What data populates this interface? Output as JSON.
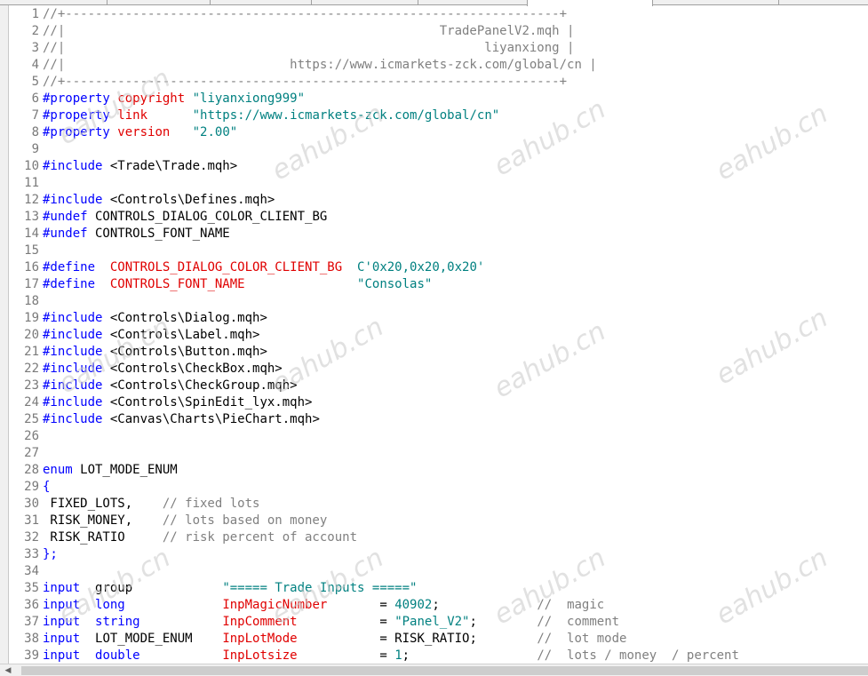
{
  "editor": {
    "lines": [
      {
        "n": "1",
        "parts": [
          [
            "c",
            "//+------------------------------------------------------------------+"
          ]
        ]
      },
      {
        "n": "2",
        "parts": [
          [
            "c",
            "//|                                                  TradePanelV2.mqh |"
          ]
        ]
      },
      {
        "n": "3",
        "parts": [
          [
            "c",
            "//|                                                        liyanxiong |"
          ]
        ]
      },
      {
        "n": "4",
        "parts": [
          [
            "c",
            "//|                              https://www.icmarkets-zck.com/global/cn |"
          ]
        ]
      },
      {
        "n": "5",
        "parts": [
          [
            "c",
            "//+------------------------------------------------------------------+"
          ]
        ]
      },
      {
        "n": "6",
        "parts": [
          [
            "k",
            "#property"
          ],
          [
            "t",
            " "
          ],
          [
            "r",
            "copyright"
          ],
          [
            "t",
            " "
          ],
          [
            "s",
            "\"liyanxiong999\""
          ]
        ]
      },
      {
        "n": "7",
        "parts": [
          [
            "k",
            "#property"
          ],
          [
            "t",
            " "
          ],
          [
            "r",
            "link"
          ],
          [
            "t",
            "      "
          ],
          [
            "s",
            "\"https://www.icmarkets-zck.com/global/cn\""
          ]
        ]
      },
      {
        "n": "8",
        "parts": [
          [
            "k",
            "#property"
          ],
          [
            "t",
            " "
          ],
          [
            "r",
            "version"
          ],
          [
            "t",
            "   "
          ],
          [
            "s",
            "\"2.00\""
          ]
        ]
      },
      {
        "n": "9",
        "parts": []
      },
      {
        "n": "10",
        "parts": [
          [
            "k",
            "#include"
          ],
          [
            "t",
            " <Trade\\Trade.mqh>"
          ]
        ]
      },
      {
        "n": "11",
        "parts": []
      },
      {
        "n": "12",
        "parts": [
          [
            "k",
            "#include"
          ],
          [
            "t",
            " <Controls\\Defines.mqh>"
          ]
        ]
      },
      {
        "n": "13",
        "parts": [
          [
            "k",
            "#undef"
          ],
          [
            "t",
            " CONTROLS_DIALOG_COLOR_CLIENT_BG"
          ]
        ]
      },
      {
        "n": "14",
        "parts": [
          [
            "k",
            "#undef"
          ],
          [
            "t",
            " CONTROLS_FONT_NAME"
          ]
        ]
      },
      {
        "n": "15",
        "parts": []
      },
      {
        "n": "16",
        "parts": [
          [
            "k",
            "#define"
          ],
          [
            "t",
            "  "
          ],
          [
            "r",
            "CONTROLS_DIALOG_COLOR_CLIENT_BG"
          ],
          [
            "t",
            "  "
          ],
          [
            "s",
            "C'0x20,0x20,0x20'"
          ]
        ]
      },
      {
        "n": "17",
        "parts": [
          [
            "k",
            "#define"
          ],
          [
            "t",
            "  "
          ],
          [
            "r",
            "CONTROLS_FONT_NAME"
          ],
          [
            "t",
            "               "
          ],
          [
            "s",
            "\"Consolas\""
          ]
        ]
      },
      {
        "n": "18",
        "parts": []
      },
      {
        "n": "19",
        "parts": [
          [
            "k",
            "#include"
          ],
          [
            "t",
            " <Controls\\Dialog.mqh>"
          ]
        ]
      },
      {
        "n": "20",
        "parts": [
          [
            "k",
            "#include"
          ],
          [
            "t",
            " <Controls\\Label.mqh>"
          ]
        ]
      },
      {
        "n": "21",
        "parts": [
          [
            "k",
            "#include"
          ],
          [
            "t",
            " <Controls\\Button.mqh>"
          ]
        ]
      },
      {
        "n": "22",
        "parts": [
          [
            "k",
            "#include"
          ],
          [
            "t",
            " <Controls\\CheckBox.mqh>"
          ]
        ]
      },
      {
        "n": "23",
        "parts": [
          [
            "k",
            "#include"
          ],
          [
            "t",
            " <Controls\\CheckGroup.mqh>"
          ]
        ]
      },
      {
        "n": "24",
        "parts": [
          [
            "k",
            "#include"
          ],
          [
            "t",
            " <Controls\\SpinEdit_lyx.mqh>"
          ]
        ]
      },
      {
        "n": "25",
        "parts": [
          [
            "k",
            "#include"
          ],
          [
            "t",
            " <Canvas\\Charts\\PieChart.mqh>"
          ]
        ]
      },
      {
        "n": "26",
        "parts": []
      },
      {
        "n": "27",
        "parts": []
      },
      {
        "n": "28",
        "parts": [
          [
            "k",
            "enum"
          ],
          [
            "t",
            " LOT_MODE_ENUM"
          ]
        ]
      },
      {
        "n": "29",
        "parts": [
          [
            "k",
            "{"
          ]
        ]
      },
      {
        "n": "30",
        "parts": [
          [
            "t",
            " FIXED_LOTS,    "
          ],
          [
            "c",
            "// fixed lots"
          ]
        ]
      },
      {
        "n": "31",
        "parts": [
          [
            "t",
            " RISK_MONEY,    "
          ],
          [
            "c",
            "// lots based on money"
          ]
        ]
      },
      {
        "n": "32",
        "parts": [
          [
            "t",
            " RISK_RATIO     "
          ],
          [
            "c",
            "// risk percent of account"
          ]
        ]
      },
      {
        "n": "33",
        "parts": [
          [
            "k",
            "};"
          ]
        ]
      },
      {
        "n": "34",
        "parts": []
      },
      {
        "n": "35",
        "parts": [
          [
            "k",
            "input"
          ],
          [
            "t",
            "  group            "
          ],
          [
            "s",
            "\"===== Trade Inputs =====\""
          ]
        ]
      },
      {
        "n": "36",
        "parts": [
          [
            "k",
            "input"
          ],
          [
            "t",
            "  "
          ],
          [
            "k",
            "long"
          ],
          [
            "t",
            "             "
          ],
          [
            "r",
            "InpMagicNumber"
          ],
          [
            "t",
            "       = "
          ],
          [
            "num",
            "40902"
          ],
          [
            "t",
            ";             "
          ],
          [
            "c",
            "//  magic"
          ]
        ]
      },
      {
        "n": "37",
        "parts": [
          [
            "k",
            "input"
          ],
          [
            "t",
            "  "
          ],
          [
            "k",
            "string"
          ],
          [
            "t",
            "           "
          ],
          [
            "r",
            "InpComment"
          ],
          [
            "t",
            "           = "
          ],
          [
            "s",
            "\"Panel_V2\""
          ],
          [
            "t",
            ";        "
          ],
          [
            "c",
            "//  comment"
          ]
        ]
      },
      {
        "n": "38",
        "parts": [
          [
            "k",
            "input"
          ],
          [
            "t",
            "  LOT_MODE_ENUM    "
          ],
          [
            "r",
            "InpLotMode"
          ],
          [
            "t",
            "           = RISK_RATIO;        "
          ],
          [
            "c",
            "//  lot mode"
          ]
        ]
      },
      {
        "n": "39",
        "parts": [
          [
            "k",
            "input"
          ],
          [
            "t",
            "  "
          ],
          [
            "k",
            "double"
          ],
          [
            "t",
            "           "
          ],
          [
            "r",
            "InpLotsize"
          ],
          [
            "t",
            "           = "
          ],
          [
            "num",
            "1"
          ],
          [
            "t",
            ";                 "
          ],
          [
            "c",
            "//  lots / money  / percent"
          ]
        ]
      }
    ]
  },
  "watermark": "eahub.cn",
  "scrollbar": {
    "left_arrow": "◀"
  }
}
